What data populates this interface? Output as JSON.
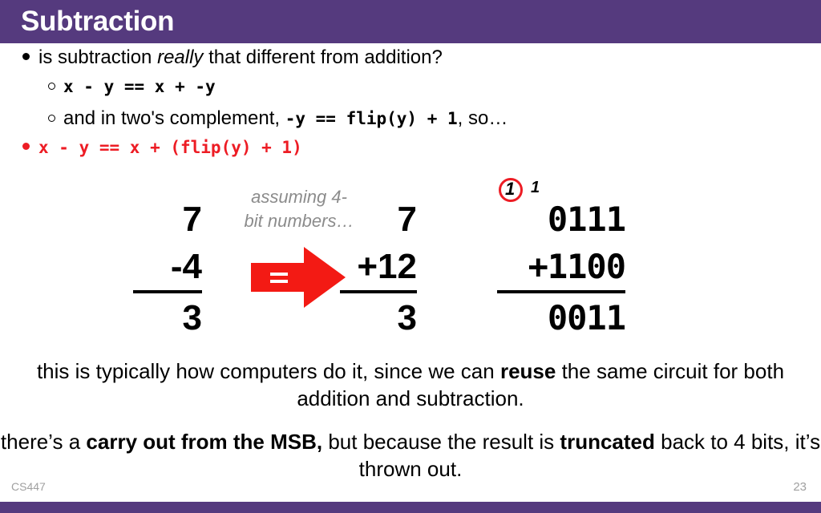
{
  "slide": {
    "title": "Subtraction",
    "accent_purple": "#553A7E",
    "accent_red": "#ED1C24",
    "gray": "#8C8C8C"
  },
  "bullets": [
    {
      "marker": "solid-dot",
      "parts": [
        {
          "text": "is subtraction ",
          "style": "plain"
        },
        {
          "text": "really",
          "style": "italic"
        },
        {
          "text": " that different from addition?",
          "style": "plain"
        }
      ]
    },
    {
      "marker": "hollow-dot",
      "parts": [
        {
          "text": "x - y == x + -y",
          "style": "mono"
        }
      ]
    },
    {
      "marker": "hollow-dot",
      "parts": [
        {
          "text": "and in two's complement, ",
          "style": "plain"
        },
        {
          "text": "-y == flip(y) + 1",
          "style": "mono"
        },
        {
          "text": ", so…",
          "style": "plain"
        }
      ]
    },
    {
      "marker": "solid-dot-red",
      "parts": [
        {
          "text": "x - y == x + (flip(y) + 1)",
          "style": "mono-red"
        }
      ]
    }
  ],
  "math": {
    "note": {
      "line1": "assuming 4-",
      "line2": "bit numbers…"
    },
    "carry": {
      "circled": "1",
      "plain": "1"
    },
    "arrow_label": "=",
    "columns": [
      {
        "name": "decimal-subtraction",
        "top": "7",
        "operand": "-4",
        "result": "3"
      },
      {
        "name": "decimal-addition",
        "top": "7",
        "operand": "+12",
        "result": "3"
      },
      {
        "name": "binary-addition",
        "top": "0111",
        "operand": "+1100",
        "result": "0011"
      }
    ]
  },
  "paragraphs": [
    {
      "name": "reuse-paragraph",
      "parts": [
        {
          "text": "this is typically how computers do it, since we can ",
          "style": "plain"
        },
        {
          "text": "reuse",
          "style": "bold"
        },
        {
          "text": " the same circuit for both addition and subtraction.",
          "style": "plain"
        }
      ]
    },
    {
      "name": "carry-out-paragraph",
      "parts": [
        {
          "text": "there’s a ",
          "style": "plain"
        },
        {
          "text": "carry out from the MSB,",
          "style": "bold"
        },
        {
          "text": " but because the result is ",
          "style": "plain"
        },
        {
          "text": "truncated",
          "style": "bold"
        },
        {
          "text": " back to 4 bits, it’s thrown out.",
          "style": "plain"
        }
      ]
    }
  ],
  "footer": {
    "course": "CS447",
    "page_number": "23"
  }
}
